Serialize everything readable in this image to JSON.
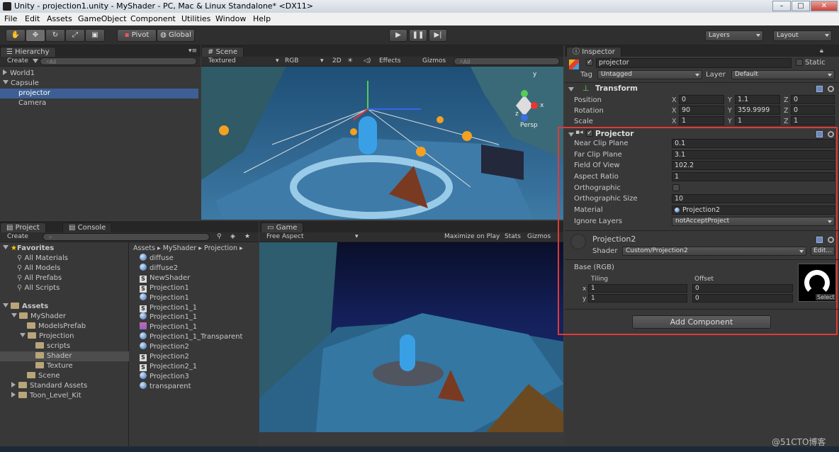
{
  "window": {
    "title": "Unity - projection1.unity - MyShader - PC, Mac & Linux Standalone* <DX11>"
  },
  "menu": [
    "File",
    "Edit",
    "Assets",
    "GameObject",
    "Component",
    "Utilities",
    "Window",
    "Help"
  ],
  "toolbar": {
    "pivot": "Pivot",
    "global": "Global",
    "layers": "Layers",
    "layout": "Layout"
  },
  "hierarchy": {
    "tab": "Hierarchy",
    "create": "Create",
    "search": "All",
    "items": [
      "World1",
      "Capsule",
      "projector",
      "Camera"
    ]
  },
  "scene": {
    "tab": "Scene",
    "shading": "Textured",
    "render": "RGB",
    "mode2d": "2D",
    "effects": "Effects",
    "gizmos": "Gizmos",
    "search": "All",
    "persp": "Persp",
    "axis_y": "y",
    "axis_x": "x",
    "axis_z": "z"
  },
  "game": {
    "tab": "Game",
    "aspect": "Free Aspect",
    "maximize": "Maximize on Play",
    "stats": "Stats",
    "gizmos": "Gizmos"
  },
  "project": {
    "tab": "Project",
    "console_tab": "Console",
    "create": "Create",
    "favorites": {
      "title": "Favorites",
      "items": [
        "All Materials",
        "All Models",
        "All Prefabs",
        "All Scripts"
      ]
    },
    "assets": {
      "title": "Assets",
      "tree": [
        "MyShader",
        "ModelsPrefab",
        "Projection",
        "scripts",
        "Shader",
        "Texture",
        "Scene",
        "Standard Assets",
        "Toon_Level_Kit"
      ]
    },
    "breadcrumb": [
      "Assets",
      "MyShader",
      "Projection"
    ],
    "files": [
      {
        "name": "diffuse",
        "kind": "material"
      },
      {
        "name": "diffuse2",
        "kind": "material"
      },
      {
        "name": "NewShader",
        "kind": "shader"
      },
      {
        "name": "Projection1",
        "kind": "shader"
      },
      {
        "name": "Projection1",
        "kind": "material"
      },
      {
        "name": "Projection1_1",
        "kind": "shader"
      },
      {
        "name": "Projection1_1",
        "kind": "material"
      },
      {
        "name": "Projection1_1",
        "kind": "texture"
      },
      {
        "name": "Projection1_1_Transparent",
        "kind": "material"
      },
      {
        "name": "Projection2",
        "kind": "material"
      },
      {
        "name": "Projection2",
        "kind": "shader"
      },
      {
        "name": "Projection2_1",
        "kind": "shader"
      },
      {
        "name": "Projection3",
        "kind": "material"
      },
      {
        "name": "transparent",
        "kind": "material"
      }
    ]
  },
  "inspector": {
    "tab": "Inspector",
    "object_name": "projector",
    "static": "Static",
    "tag_label": "Tag",
    "tag": "Untagged",
    "layer_label": "Layer",
    "layer": "Default",
    "transform": {
      "title": "Transform",
      "position": {
        "label": "Position",
        "x": "0",
        "y": "1.1",
        "z": "0"
      },
      "rotation": {
        "label": "Rotation",
        "x": "90",
        "y": "359.9999",
        "z": "0"
      },
      "scale": {
        "label": "Scale",
        "x": "1",
        "y": "1",
        "z": "1"
      }
    },
    "projector": {
      "title": "Projector",
      "near_label": "Near Clip Plane",
      "near": "0.1",
      "far_label": "Far Clip Plane",
      "far": "3.1",
      "fov_label": "Field Of View",
      "fov": "102.2",
      "aspect_label": "Aspect Ratio",
      "aspect": "1",
      "ortho_label": "Orthographic",
      "ortho_size_label": "Orthographic Size",
      "ortho_size": "10",
      "material_label": "Material",
      "material": "Projection2",
      "ignore_label": "Ignore Layers",
      "ignore": "notAcceptProject"
    },
    "material": {
      "name": "Projection2",
      "shader_label": "Shader",
      "shader": "Custom/Projection2",
      "edit": "Edit...",
      "base_label": "Base (RGB)",
      "tiling": "Tiling",
      "offset": "Offset",
      "x_label": "x",
      "y_label": "y",
      "tx": "1",
      "ty": "1",
      "ox": "0",
      "oy": "0",
      "select": "Select"
    },
    "add_component": "Add Component"
  },
  "watermark": "@51CTO博客",
  "colors": {
    "highlight": "#e03a3a",
    "selection": "#3d5f95"
  }
}
